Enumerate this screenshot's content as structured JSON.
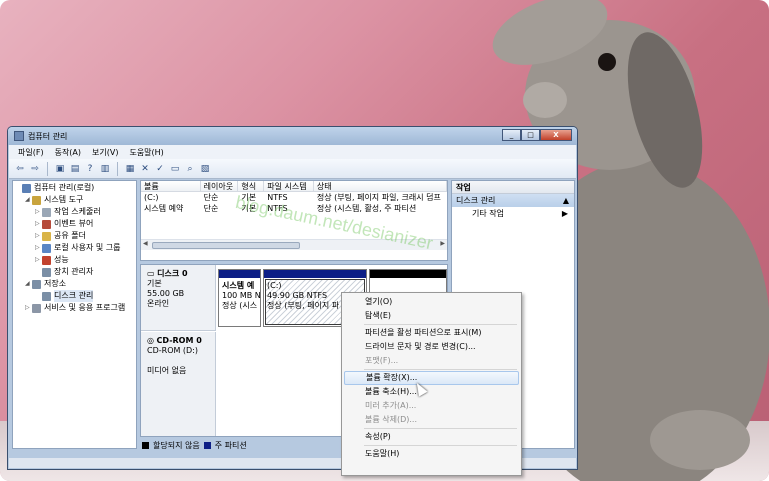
{
  "window": {
    "title": "컴퓨터 관리",
    "buttons": [
      "_",
      "□",
      "X"
    ]
  },
  "menu": [
    "파일(F)",
    "동작(A)",
    "보기(V)",
    "도움말(H)"
  ],
  "toolbar_icons": [
    "back-arrow-icon",
    "forward-arrow-icon",
    "folder-up-icon",
    "show-hide-tree-icon",
    "help-icon",
    "action-pane-icon",
    "properties-icon",
    "delete-icon",
    "checkmark-icon",
    "open-folder-icon",
    "search-icon",
    "properties-sheet-icon"
  ],
  "tree": [
    {
      "label": "컴퓨터 관리(로컬)",
      "level": 0,
      "arrow": "",
      "icon": "computer-icon",
      "color": "#5a7fb5"
    },
    {
      "label": "시스템 도구",
      "level": 1,
      "arrow": "◢",
      "icon": "tools-icon",
      "color": "#c9a43d"
    },
    {
      "label": "작업 스케줄러",
      "level": 2,
      "arrow": "▷",
      "icon": "clock-icon",
      "color": "#9aa7b6"
    },
    {
      "label": "이벤트 뷰어",
      "level": 2,
      "arrow": "▷",
      "icon": "event-viewer-icon",
      "color": "#b64b3a"
    },
    {
      "label": "공유 폴더",
      "level": 2,
      "arrow": "▷",
      "icon": "shared-folder-icon",
      "color": "#d9b448"
    },
    {
      "label": "로컬 사용자 및 그룹",
      "level": 2,
      "arrow": "▷",
      "icon": "users-icon",
      "color": "#5a86c5"
    },
    {
      "label": "성능",
      "level": 2,
      "arrow": "▷",
      "icon": "performance-icon",
      "color": "#c2422e"
    },
    {
      "label": "장치 관리자",
      "level": 2,
      "arrow": "",
      "icon": "device-manager-icon",
      "color": "#7b8fa6"
    },
    {
      "label": "저장소",
      "level": 1,
      "arrow": "◢",
      "icon": "storage-icon",
      "color": "#7b8fa6"
    },
    {
      "label": "디스크 관리",
      "level": 2,
      "arrow": "",
      "icon": "disk-management-icon",
      "color": "#7b8fa6",
      "selected": true
    },
    {
      "label": "서비스 및 응용 프로그램",
      "level": 1,
      "arrow": "▷",
      "icon": "services-icon",
      "color": "#8b96a6"
    }
  ],
  "volumes": {
    "headers": [
      "볼륨",
      "레이아웃",
      "형식",
      "파일 시스템",
      "상태"
    ],
    "rows": [
      [
        "(C:)",
        "단순",
        "기본",
        "NTFS",
        "정상 (부팅, 페이지 파일, 크래시 덤프"
      ],
      [
        "시스템 예약",
        "단순",
        "기본",
        "NTFS",
        "정상 (시스템, 활성, 주 파티션"
      ]
    ],
    "scroll_mark": "III"
  },
  "disks": [
    {
      "name": "디스크 0",
      "type": "기본",
      "size": "55.00 GB",
      "status": "온라인",
      "partitions": [
        {
          "title": "시스템 예",
          "size": "100 MB N",
          "status": "정상 (시스"
        },
        {
          "title": "(C:)",
          "size": "49.90 GB NTFS",
          "status": "정상 (부팅, 페이지 파"
        }
      ]
    },
    {
      "name": "CD-ROM 0",
      "type": "CD-ROM (D:)",
      "status": "미디어 없음"
    }
  ],
  "legend": [
    {
      "label": "할당되지 않음",
      "color": "#000000"
    },
    {
      "label": "주 파티션",
      "color": "#0c1e86"
    }
  ],
  "actions": {
    "header": "작업",
    "section": "디스크 관리",
    "more": "기타 작업"
  },
  "context_menu": [
    {
      "label": "열기(O)",
      "enabled": true
    },
    {
      "label": "탐색(E)",
      "enabled": true
    },
    {
      "sep": true
    },
    {
      "label": "파티션을 활성 파티션으로 표시(M)",
      "enabled": true
    },
    {
      "label": "드라이브 문자 및 경로 변경(C)...",
      "enabled": true
    },
    {
      "label": "포맷(F)...",
      "enabled": false
    },
    {
      "sep": true
    },
    {
      "label": "볼륨 확장(X)...",
      "enabled": true,
      "highlighted": true
    },
    {
      "label": "볼륨 축소(H)...",
      "enabled": true
    },
    {
      "label": "미러 추가(A)...",
      "enabled": false
    },
    {
      "label": "볼륨 삭제(D)...",
      "enabled": false
    },
    {
      "sep": true
    },
    {
      "label": "속성(P)",
      "enabled": true
    },
    {
      "sep": true
    },
    {
      "label": "도움말(H)",
      "enabled": true
    }
  ],
  "watermark": "blog.daum.net/desianizer"
}
